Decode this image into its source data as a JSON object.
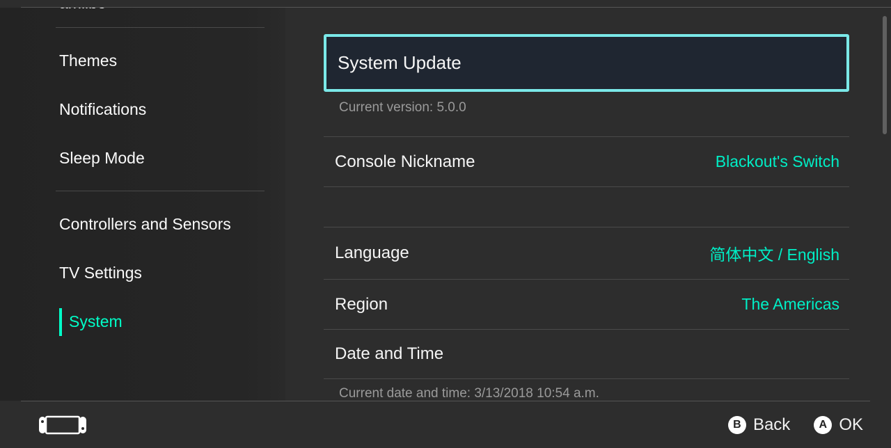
{
  "sidebar": {
    "partial_top": "amiibo",
    "group1": [
      {
        "label": "Themes"
      },
      {
        "label": "Notifications"
      },
      {
        "label": "Sleep Mode"
      }
    ],
    "group2": [
      {
        "label": "Controllers and Sensors"
      },
      {
        "label": "TV Settings"
      },
      {
        "label": "System",
        "active": true
      }
    ]
  },
  "main": {
    "system_update": "System Update",
    "current_version_label": "Current version: 5.0.0",
    "rows": [
      {
        "label": "Console Nickname",
        "value": "Blackout's Switch"
      },
      {
        "label": "Language",
        "value": "简体中文 / English"
      },
      {
        "label": "Region",
        "value": "The Americas"
      },
      {
        "label": "Date and Time",
        "value": ""
      }
    ],
    "current_datetime_label": "Current date and time: 3/13/2018 10:54 a.m."
  },
  "footer": {
    "back_key": "B",
    "back_label": "Back",
    "ok_key": "A",
    "ok_label": "OK"
  }
}
